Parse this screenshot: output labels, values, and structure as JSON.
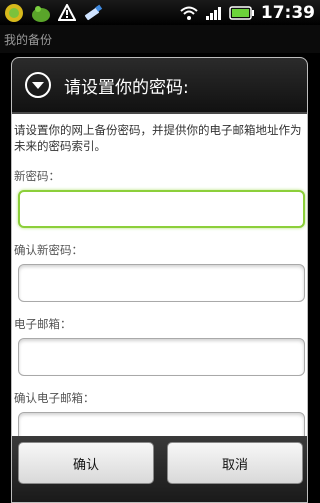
{
  "status_bar": {
    "time": "17:39",
    "icons": [
      "app-icon",
      "shield-icon",
      "warning-icon",
      "usb-icon",
      "wifi-icon",
      "signal-icon",
      "battery-icon"
    ]
  },
  "title_bar": {
    "title": "我的备份"
  },
  "dialog": {
    "title": "请设置你的密码:",
    "description": "请设置你的网上备份密码，并提供你的电子邮箱地址作为未来的密码索引。",
    "fields": [
      {
        "label": "新密码：",
        "value": "",
        "focused": true
      },
      {
        "label": "确认新密码：",
        "value": ""
      },
      {
        "label": "电子邮箱：",
        "value": ""
      },
      {
        "label": "确认电子邮箱：",
        "value": ""
      }
    ],
    "confirm_label": "确认",
    "cancel_label": "取消"
  },
  "colors": {
    "focus_border": "#8ccf3a",
    "header_bg": "#1b1b1b",
    "dialog_bg": "#ffffff"
  }
}
